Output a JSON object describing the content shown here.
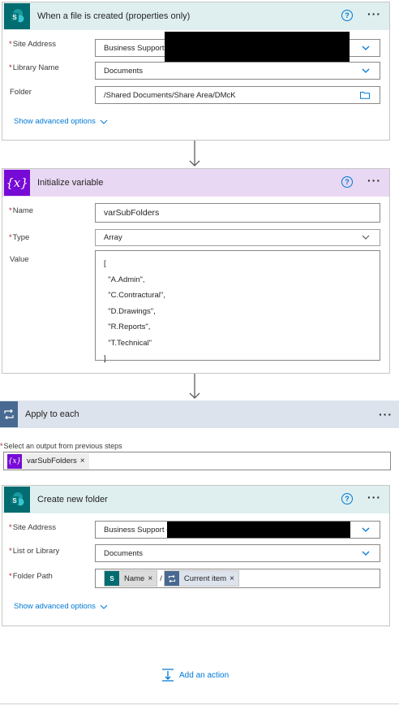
{
  "trigger": {
    "title": "When a file is created (properties only)",
    "site_address_label": "Site Address",
    "site_address_value": "Business Support",
    "library_label": "Library Name",
    "library_value": "Documents",
    "folder_label": "Folder",
    "folder_value": "/Shared Documents/Share Area/DMcK",
    "advanced": "Show advanced options"
  },
  "init_var": {
    "title": "Initialize variable",
    "name_label": "Name",
    "name_value": "varSubFolders",
    "type_label": "Type",
    "type_value": "Array",
    "value_label": "Value",
    "value_lines": [
      "[",
      "  \"A.Admin\",",
      "  \"C.Contractural\",",
      "  \"D.Drawings\",",
      "  \"R.Reports\",",
      "  \"T.Technical\"",
      "]"
    ]
  },
  "apply_each": {
    "title": "Apply to each",
    "select_label": "Select an output from previous steps",
    "token": "varSubFolders",
    "token_remove": "×"
  },
  "create_folder": {
    "title": "Create new folder",
    "site_address_label": "Site Address",
    "site_address_value": "Business Support -",
    "list_label": "List or Library",
    "list_value": "Documents",
    "path_label": "Folder Path",
    "token_name": "Name",
    "separator": "/",
    "token_current": "Current item",
    "token_remove": "×",
    "advanced": "Show advanced options"
  },
  "add_action": "Add an action",
  "help_glyph": "?",
  "more_glyph": "···",
  "colors": {
    "sharepoint": "#036c70",
    "variable": "#770bd6",
    "loop": "#486991",
    "link": "#0078d4",
    "required": "#a4262c"
  },
  "icons": [
    "sharepoint-icon",
    "variable-icon",
    "loop-icon",
    "help-icon",
    "more-icon",
    "chevron-down-icon",
    "folder-picker-icon",
    "add-action-icon"
  ]
}
